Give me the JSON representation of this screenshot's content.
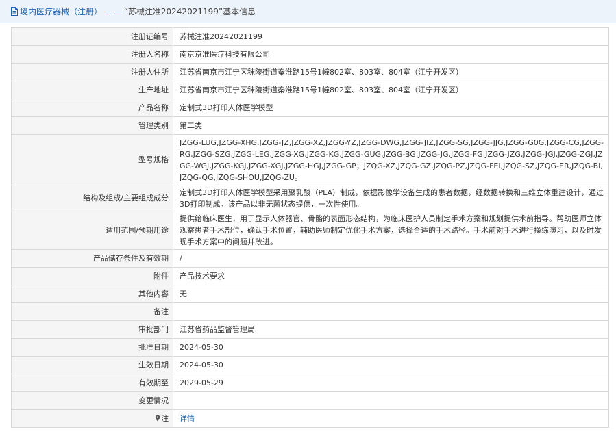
{
  "header": {
    "section": "境内医疗器械（注册）",
    "separator": "——",
    "record_title": "“苏械注准20242021199”基本信息"
  },
  "rows": [
    {
      "label": "注册证编号",
      "value": "苏械注准20242021199"
    },
    {
      "label": "注册人名称",
      "value": "南京京准医疗科技有限公司"
    },
    {
      "label": "注册人住所",
      "value": "江苏省南京市江宁区秣陵街道秦淮路15号1幢802室、803室、804室（江宁开发区）"
    },
    {
      "label": "生产地址",
      "value": "江苏省南京市江宁区秣陵街道秦淮路15号1幢802室、803室、804室（江宁开发区）"
    },
    {
      "label": "产品名称",
      "value": "定制式3D打印人体医学模型"
    },
    {
      "label": "管理类别",
      "value": "第二类"
    },
    {
      "label": "型号规格",
      "value": "JZGG-LUG,JZGG-XHG,JZGG-JZ,JZGG-XZ,JZGG-YZ,JZGG-DWG,JZGG-JIZ,JZGG-SG,JZGG-JJG,JZGG-G0G,JZGG-CG,JZGG-RG,JZGG-SZG,JZGG-LEG,JZGG-XG,JZGG-KG,JZGG-GUG,JZGG-BG,JZGG-JG,JZGG-FG,JZGG-JZG,JZGG-JGJ,JZGG-ZGJ,JZGG-WGJ,JZGG-KGJ,JZGG-XGJ,JZGG-HGJ,JZGG-GP；JZQG-XZ,JZQG-GZ,JZQG-PZ,JZQG-FEI,JZQG-SZ,JZQG-ER,JZQG-BI,JZQG-QG,JZQG-SHOU,JZQG-ZU。"
    },
    {
      "label": "结构及组成/主要组成成分",
      "value": "定制式3D打印人体医学模型采用聚乳酸（PLA）制成，依据影像学设备生成的患者数据，经数据转换和三维立体重建设计，通过3D打印制成。该产品以非无菌状态提供，一次性使用。"
    },
    {
      "label": "适用范围/预期用途",
      "value": "提供给临床医生，用于显示人体器官、骨骼的表面形态结构，为临床医护人员制定手术方案和规划提供术前指导。帮助医师立体观察患者手术部位，确认手术位置，辅助医师制定优化手术方案，选择合适的手术路径。手术前对手术进行操练演习，以及时发现手术方案中的问题并改进。"
    },
    {
      "label": "产品储存条件及有效期",
      "value": "/"
    },
    {
      "label": "附件",
      "value": "产品技术要求"
    },
    {
      "label": "其他内容",
      "value": "无"
    },
    {
      "label": "备注",
      "value": ""
    },
    {
      "label": "审批部门",
      "value": "江苏省药品监督管理局"
    },
    {
      "label": "批准日期",
      "value": "2024-05-30"
    },
    {
      "label": "生效日期",
      "value": "2024-05-30"
    },
    {
      "label": "有效期至",
      "value": "2029-05-29"
    },
    {
      "label": "变更情况",
      "value": ""
    }
  ],
  "note_row": {
    "label": "注",
    "icon": "pin-icon",
    "link_text": "详情"
  },
  "colors": {
    "link": "#1a62b0",
    "header_bg": "#edf3fa",
    "label_bg": "#f5f5f5",
    "border": "#d8d8d8"
  }
}
